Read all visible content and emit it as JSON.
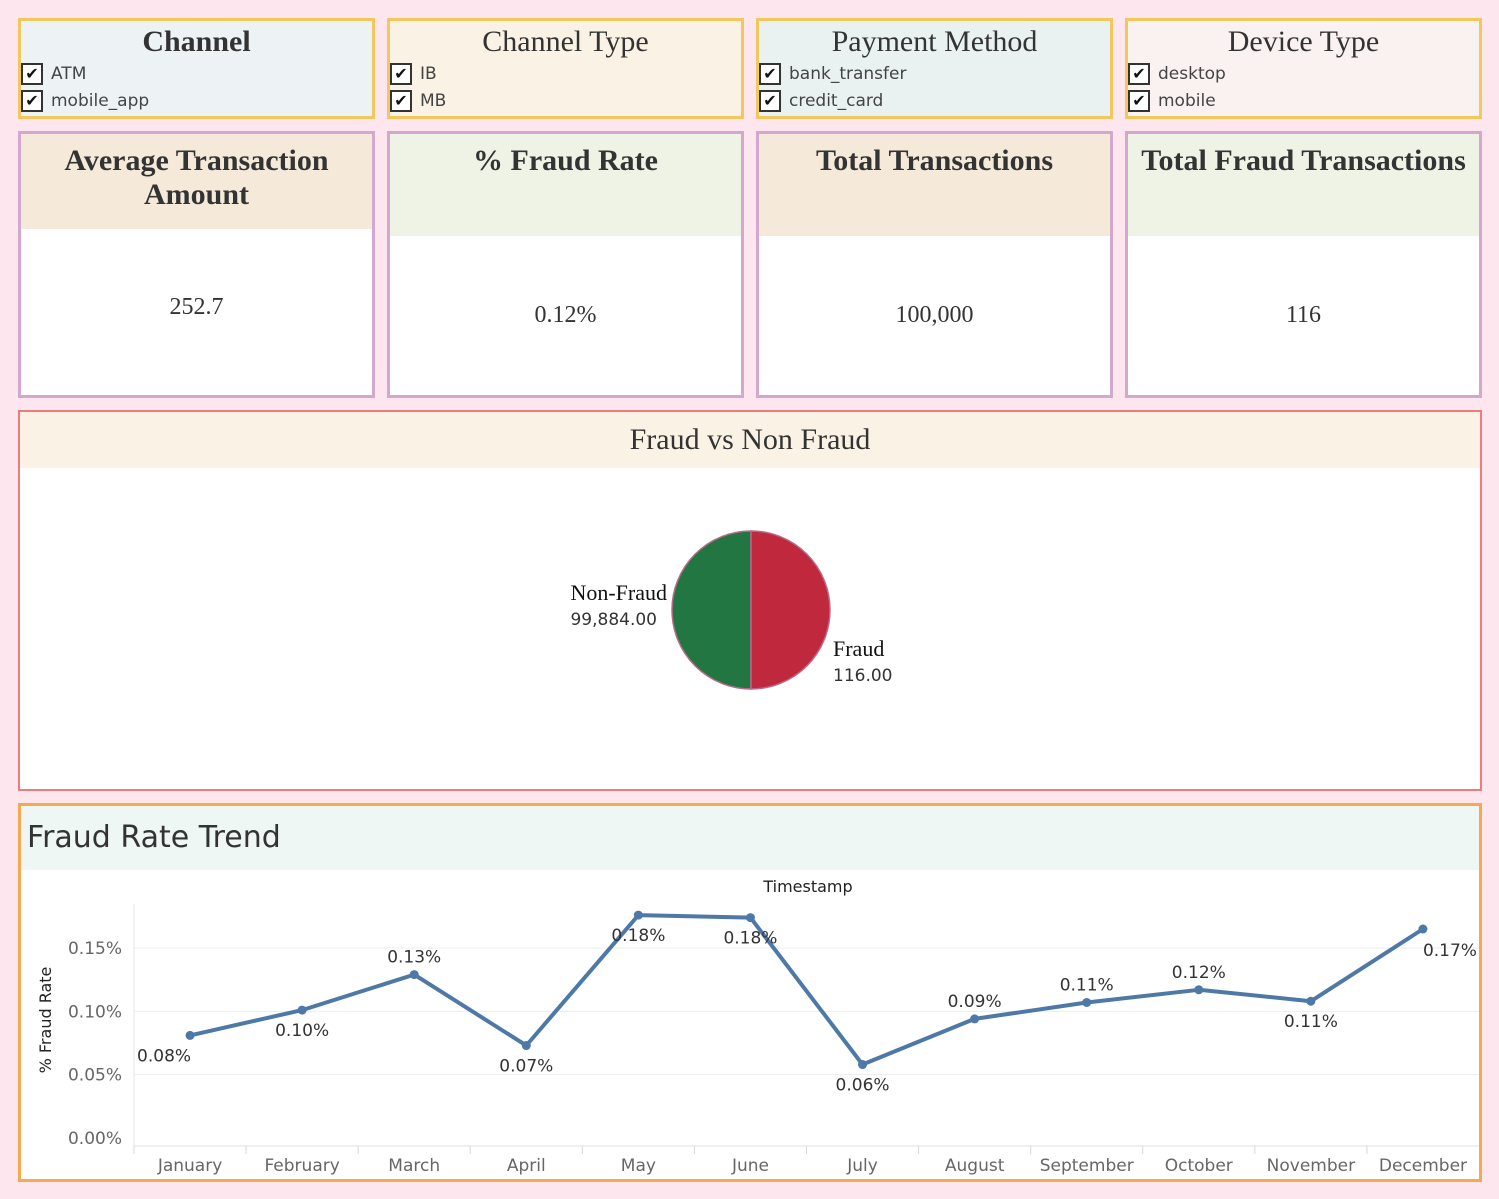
{
  "filters": [
    {
      "title": "Channel",
      "bold": true,
      "bg": "#edf3f5",
      "items": [
        "ATM",
        "mobile_app"
      ]
    },
    {
      "title": "Channel Type",
      "bold": false,
      "bg": "#faf2e4",
      "items": [
        "IB",
        "MB"
      ]
    },
    {
      "title": "Payment Method",
      "bold": false,
      "bg": "#e9f2f1",
      "items": [
        "bank_transfer",
        "credit_card"
      ]
    },
    {
      "title": "Device Type",
      "bold": false,
      "bg": "#faf1f1",
      "items": [
        "desktop",
        "mobile"
      ]
    }
  ],
  "kpis": [
    {
      "title": "Average Transaction Amount",
      "value": "252.7",
      "head_bg": "#f5e9d9"
    },
    {
      "title": "% Fraud Rate",
      "value": "0.12%",
      "head_bg": "#eef3e5"
    },
    {
      "title": "Total Transactions",
      "value": "100,000",
      "head_bg": "#f5e9d9"
    },
    {
      "title": "Total Fraud Transactions",
      "value": "116",
      "head_bg": "#eef3e5"
    }
  ],
  "pie": {
    "title": "Fraud vs  Non Fraud",
    "nonfraud_label": "Non-Fraud",
    "nonfraud_value": "99,884.00",
    "fraud_label": "Fraud",
    "fraud_value": "116.00"
  },
  "trend": {
    "title": "Fraud Rate Trend",
    "top_axis_label": "Timestamp",
    "y_axis_label": "% Fraud Rate"
  },
  "colors": {
    "line": "#4e79a7",
    "fraud": "#c0283d",
    "nonfraud": "#217641",
    "panel_border_filter": "#f2c75c",
    "panel_border_kpi": "#d4a7cf"
  },
  "chart_data": [
    {
      "type": "pie",
      "title": "Fraud vs  Non Fraud",
      "slices": [
        {
          "label": "Non-Fraud",
          "value": 99884.0,
          "display": "99,884.00",
          "color": "#217641"
        },
        {
          "label": "Fraud",
          "value": 116.0,
          "display": "116.00",
          "color": "#c0283d"
        }
      ],
      "note": "rendered as two equal halves in the dashboard"
    },
    {
      "type": "line",
      "title": "Fraud Rate Trend",
      "xlabel": "Timestamp",
      "ylabel": "% Fraud Rate",
      "categories": [
        "January",
        "February",
        "March",
        "April",
        "May",
        "June",
        "July",
        "August",
        "September",
        "October",
        "November",
        "December"
      ],
      "values": [
        0.081,
        0.101,
        0.129,
        0.073,
        0.176,
        0.174,
        0.058,
        0.094,
        0.107,
        0.117,
        0.108,
        0.165
      ],
      "labels": [
        "0.08%",
        "0.10%",
        "0.13%",
        "0.07%",
        "0.18%",
        "0.18%",
        "0.06%",
        "0.09%",
        "0.11%",
        "0.12%",
        "0.11%",
        "0.17%"
      ],
      "ylim": [
        0,
        0.18
      ],
      "yticks": [
        "0.00%",
        "0.05%",
        "0.10%",
        "0.15%"
      ],
      "ytick_values": [
        0,
        0.05,
        0.1,
        0.15
      ],
      "grid": true
    }
  ]
}
